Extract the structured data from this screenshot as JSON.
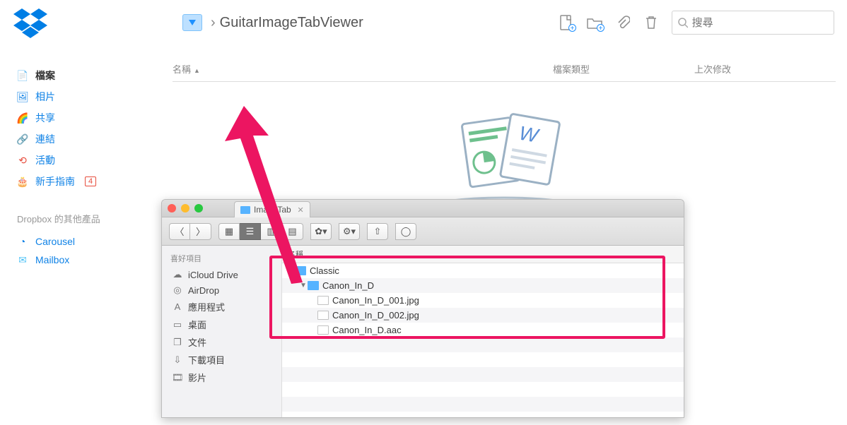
{
  "dropbox": {
    "breadcrumb_title": "GuitarImageTabViewer",
    "search_placeholder": "搜尋",
    "columns": {
      "name": "名稱",
      "type": "檔案類型",
      "modified": "上次修改"
    },
    "sidebar_heading": "Dropbox 的其他產品",
    "nav": [
      {
        "label": "檔案",
        "icon": "file"
      },
      {
        "label": "相片",
        "icon": "photo"
      },
      {
        "label": "共享",
        "icon": "rainbow"
      },
      {
        "label": "連結",
        "icon": "link"
      },
      {
        "label": "活動",
        "icon": "clock"
      },
      {
        "label": "新手指南",
        "icon": "cake",
        "badge": "4"
      }
    ],
    "products": [
      {
        "label": "Carousel",
        "icon": "carousel"
      },
      {
        "label": "Mailbox",
        "icon": "mailbox"
      }
    ]
  },
  "finder": {
    "tab_title": "ImageTab",
    "favorites_heading": "喜好項目",
    "col_name": "名稱",
    "favorites": [
      {
        "label": "iCloud Drive",
        "icon": "☁"
      },
      {
        "label": "AirDrop",
        "icon": "◎"
      },
      {
        "label": "應用程式",
        "icon": "A"
      },
      {
        "label": "桌面",
        "icon": "▭"
      },
      {
        "label": "文件",
        "icon": "❐"
      },
      {
        "label": "下載項目",
        "icon": "⇩"
      },
      {
        "label": "影片",
        "icon": "🎞"
      }
    ],
    "tree": {
      "root": "Classic",
      "child": "Canon_In_D",
      "files": [
        "Canon_In_D_001.jpg",
        "Canon_In_D_002.jpg",
        "Canon_In_D.aac"
      ]
    }
  }
}
